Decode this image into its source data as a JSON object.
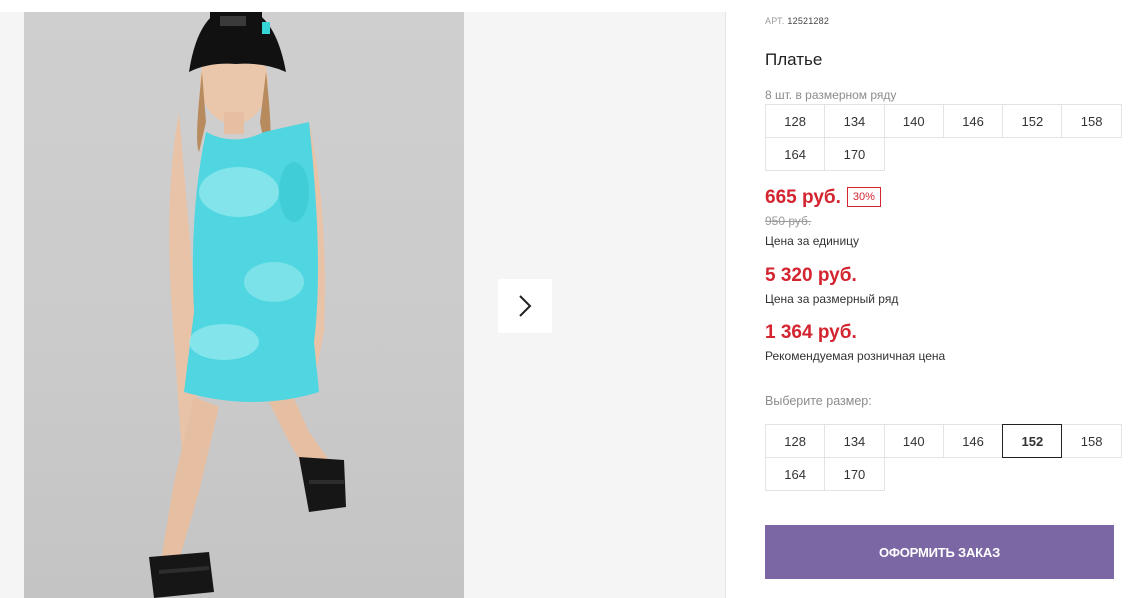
{
  "product": {
    "article_label": "АРТ.",
    "article_number": "12521282",
    "title": "Платье"
  },
  "gallery": {
    "next_icon": "chevron-right-icon"
  },
  "size_row": {
    "caption": "8 шт. в размерном ряду",
    "sizes": [
      "128",
      "134",
      "140",
      "146",
      "152",
      "158",
      "164",
      "170"
    ]
  },
  "prices": {
    "unit_price": "665 руб.",
    "discount": "30%",
    "old_price": "950 руб.",
    "unit_label": "Цена за единицу",
    "row_price": "5 320 руб.",
    "row_label": "Цена за размерный ряд",
    "retail_price": "1 364 руб.",
    "retail_label": "Рекомендуемая розничная цена"
  },
  "size_select": {
    "caption": "Выберите размер:",
    "sizes": [
      "128",
      "134",
      "140",
      "146",
      "152",
      "158",
      "164",
      "170"
    ],
    "selected": "152"
  },
  "order_button": {
    "label": "ОФОРМИТЬ ЗАКАЗ"
  },
  "colors": {
    "accent_red": "#d3242f",
    "button_purple": "#7c67a5",
    "dress": "#4fd6e0"
  }
}
